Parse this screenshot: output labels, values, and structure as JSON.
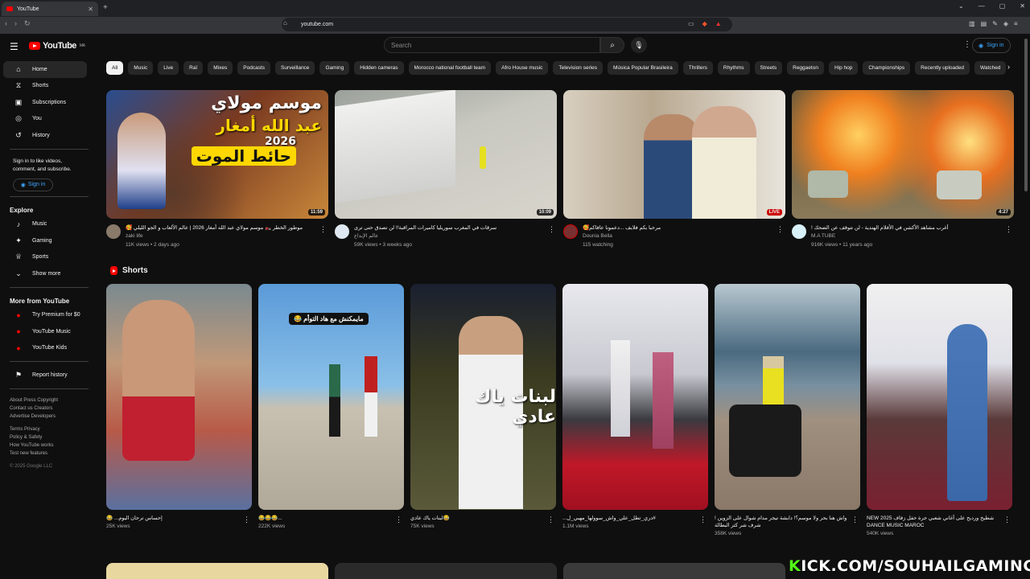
{
  "browser": {
    "tab_title": "YouTube",
    "url": "youtube.com"
  },
  "header": {
    "logo_text": "YouTube",
    "logo_region": "MA",
    "search_placeholder": "Search",
    "signin_label": "Sign in"
  },
  "sidebar": {
    "main": [
      {
        "label": "Home",
        "icon": "home-icon"
      },
      {
        "label": "Shorts",
        "icon": "shorts-icon"
      },
      {
        "label": "Subscriptions",
        "icon": "subscriptions-icon"
      },
      {
        "label": "You",
        "icon": "you-icon"
      },
      {
        "label": "History",
        "icon": "history-icon"
      }
    ],
    "signin_prompt": "Sign in to like videos, comment, and subscribe.",
    "signin_label": "Sign in",
    "explore_heading": "Explore",
    "explore": [
      {
        "label": "Music",
        "icon": "music-icon"
      },
      {
        "label": "Gaming",
        "icon": "gaming-icon"
      },
      {
        "label": "Sports",
        "icon": "sports-icon"
      },
      {
        "label": "Show more",
        "icon": "chevron-down-icon"
      }
    ],
    "more_heading": "More from YouTube",
    "more": [
      {
        "label": "Try Premium for $0"
      },
      {
        "label": "YouTube Music"
      },
      {
        "label": "YouTube Kids"
      }
    ],
    "report_history": "Report history",
    "footer1": "About  Press  Copyright",
    "footer2": "Contact us  Creators",
    "footer3": "Advertise  Developers",
    "footer4": "Terms  Privacy",
    "footer5": "Policy & Safety",
    "footer6": "How YouTube works",
    "footer7": "Test new features",
    "copyright": "© 2025 Google LLC"
  },
  "chips": [
    "All",
    "Music",
    "Live",
    "Raï",
    "Mixes",
    "Podcasts",
    "Surveillance",
    "Gaming",
    "Hidden cameras",
    "Morocco national football team",
    "Afro House music",
    "Television series",
    "Música Popular Brasileira",
    "Thrillers",
    "Rhythms",
    "Streets",
    "Reggaeton",
    "Hip hop",
    "Championships",
    "Recently uploaded",
    "Watched"
  ],
  "videos": [
    {
      "title": "موطور الخطر 🏍️ موسم مولاي عبد الله أمغار 2026 | عالم الألعاب و الجو الليلي 🥰",
      "channel": "zaki life",
      "stats": "11K views • 2 days ago",
      "badge": "11:59",
      "overlay1": "موسم مولاي",
      "overlay2": "عبد الله أمغار",
      "overlay3": "2026",
      "overlay4": "حائط الموت"
    },
    {
      "title": "سرقات في المغرب سوريليا كاميرات المراقبة!! لن تصدق حتى ترى",
      "channel": "عالم الإبداع",
      "stats": "59K views • 3 weeks ago",
      "badge": "10:09"
    },
    {
      "title": "مرحبا بكم فلايف ...دعمونا عافاكم🥰",
      "channel": "Dounia Bella",
      "stats": "115 watching",
      "badge": "LIVE"
    },
    {
      "title": "أغرب مشاهد الأكشن في الأفلام الهندية - لن تتوقف عن الضحك !",
      "channel": "M.A TUBE",
      "stats": "916K views • 11 years ago",
      "badge": "4:27"
    }
  ],
  "shorts_heading": "Shorts",
  "shorts": [
    {
      "title": "😂 ...إحساس ترحان اليوم",
      "views": "25K views"
    },
    {
      "title": "😂😂😂...",
      "views": "222K views",
      "overlay": "مايمكنش مع هاد التوأم 😂"
    },
    {
      "title": "لبنات ياك عادي😂",
      "views": "75K views",
      "overlay": "لبنات ياك عادي"
    },
    {
      "title": "...دري_تطل_علي_واش_سوولها_مهبي_ل#",
      "views": "1.1M views"
    },
    {
      "title": "واش هنا بحر ولا موسم؟! دابشة تيجر مدام شوال على الزوين ! شرف شر كثر البطالة",
      "views": "358K views"
    },
    {
      "title": "NEW 2025 شطيح ورديح على أغاني شعبي جرة حفل زفاف DANCE MUSIC MAROC",
      "views": "540K views"
    }
  ],
  "watermark": {
    "prefix": "K",
    "rest": "ICK.COM/SOUHAILGAMING"
  }
}
